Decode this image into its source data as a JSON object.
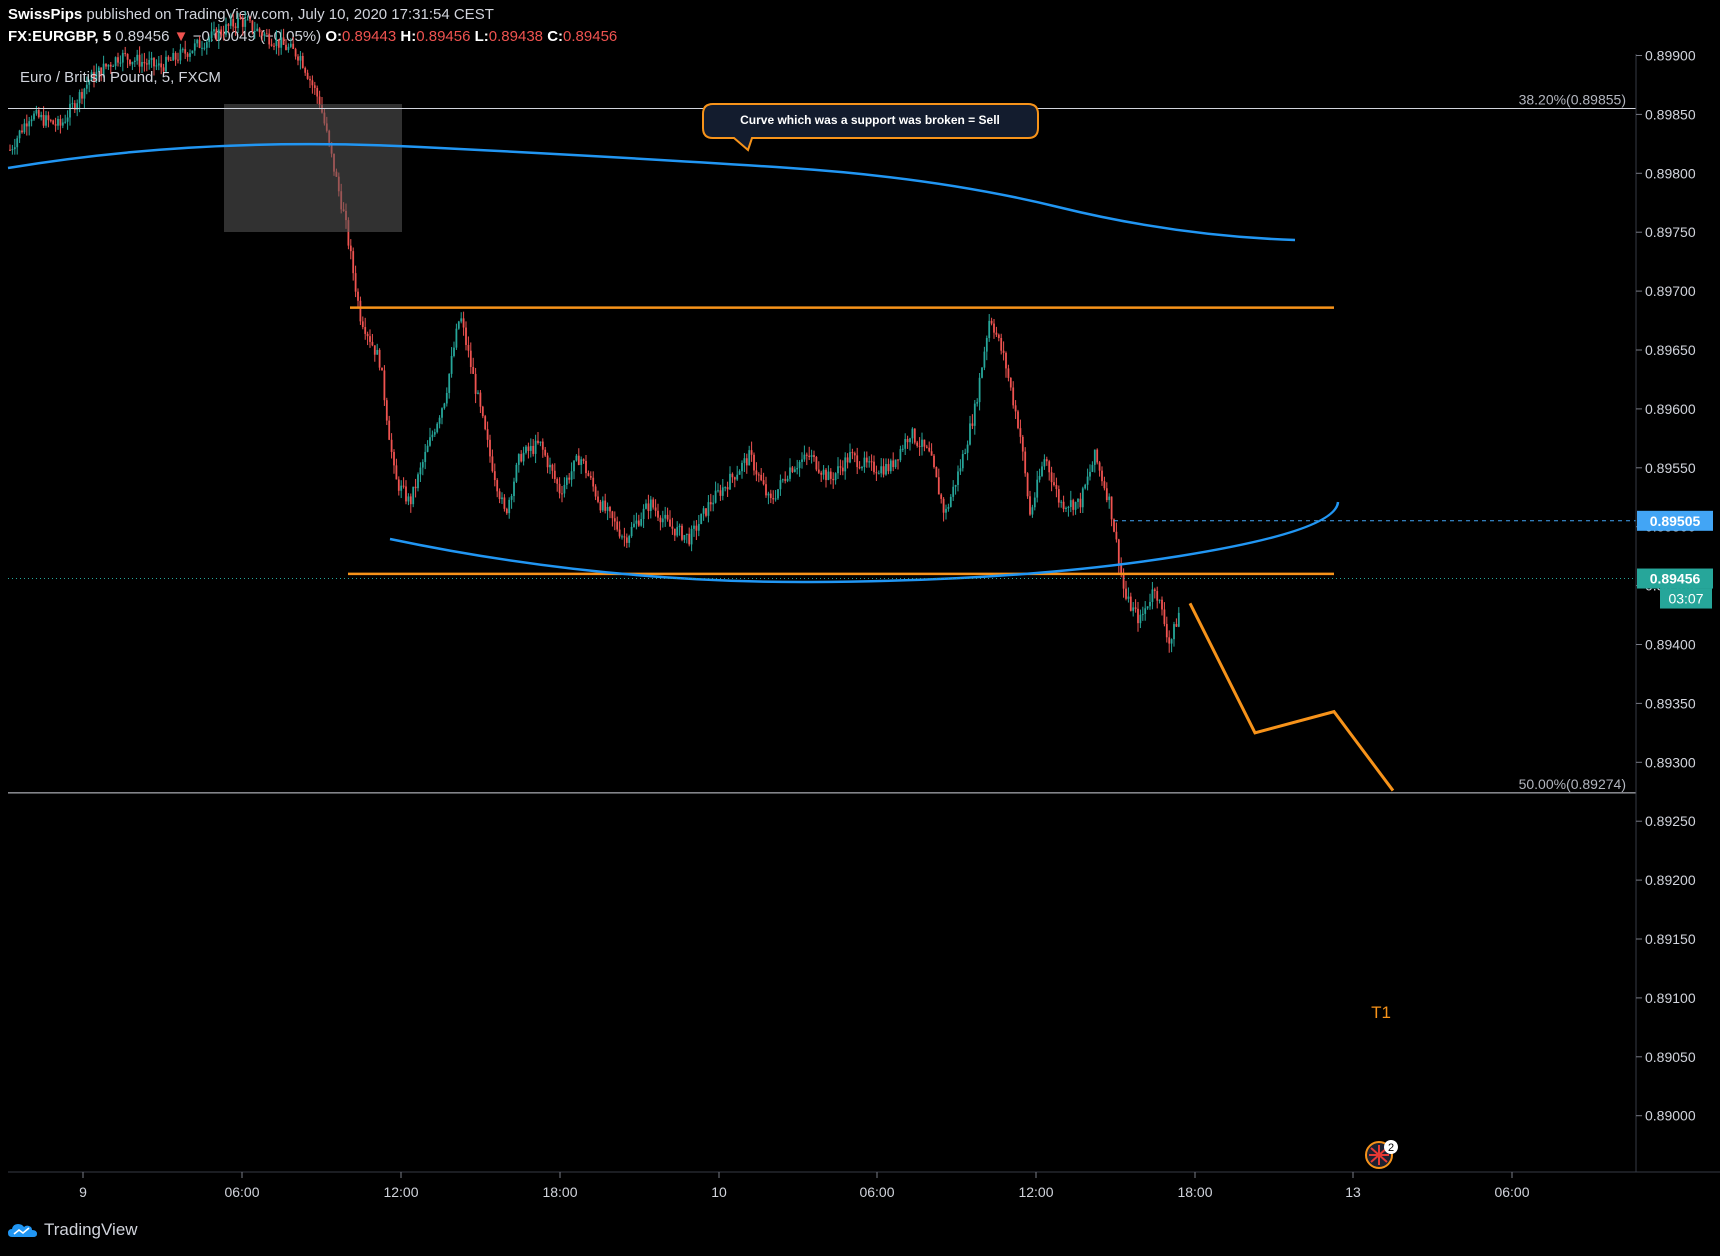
{
  "header": {
    "publisher": "SwissPips",
    "published_text": "published on TradingView.com, July 10, 2020 17:31:54 CEST",
    "symbol": "FX:EURGBP, 5",
    "last": "0.89456",
    "change": "−0.00049 (−0.05%)",
    "o_label": "O:",
    "o_value": "0.89443",
    "h_label": "H:",
    "h_value": "0.89456",
    "l_label": "L:",
    "l_value": "0.89438",
    "c_label": "C:",
    "c_value": "0.89456"
  },
  "footer": {
    "brand": "TradingView"
  },
  "colors": {
    "background": "#000000",
    "bull": "#26a69a",
    "bear": "#ef5350",
    "curve": "#2196f3",
    "orange": "#f7931a",
    "accent_teal": "#26a69a",
    "accent_blue": "#42a5f5"
  },
  "chart_data": {
    "type": "candlestick",
    "title": "Euro / British Pound, 5, FXCM",
    "x_ticks": [
      "9",
      "06:00",
      "12:00",
      "18:00",
      "10",
      "06:00",
      "12:00",
      "18:00",
      "13",
      "06:00"
    ],
    "y_ticks": [
      "0.89900",
      "0.89850",
      "0.89800",
      "0.89750",
      "0.89700",
      "0.89650",
      "0.89600",
      "0.89550",
      "0.89500",
      "0.89450",
      "0.89400",
      "0.89350",
      "0.89300",
      "0.89250",
      "0.89200",
      "0.89150",
      "0.89100",
      "0.89050",
      "0.89000"
    ],
    "ylim": [
      0.8896,
      0.899
    ],
    "fib_levels": [
      {
        "label": "38.20%(0.89855)",
        "value": 0.89855
      },
      {
        "label": "50.00%(0.89274)",
        "value": 0.89274
      }
    ],
    "price_labels": [
      {
        "text": "0.89505",
        "value": 0.89505,
        "kind": "dashed-blue"
      },
      {
        "text": "0.89456",
        "value": 0.89456,
        "kind": "last"
      }
    ],
    "countdown": "03:07",
    "annotation": "Curve which was a support was broken = Sell",
    "target_label": "T1",
    "event_badge": "2",
    "resistance": 0.89686,
    "support": 0.8946,
    "projection": [
      0.89435,
      0.89325,
      0.89343,
      0.89276
    ]
  }
}
